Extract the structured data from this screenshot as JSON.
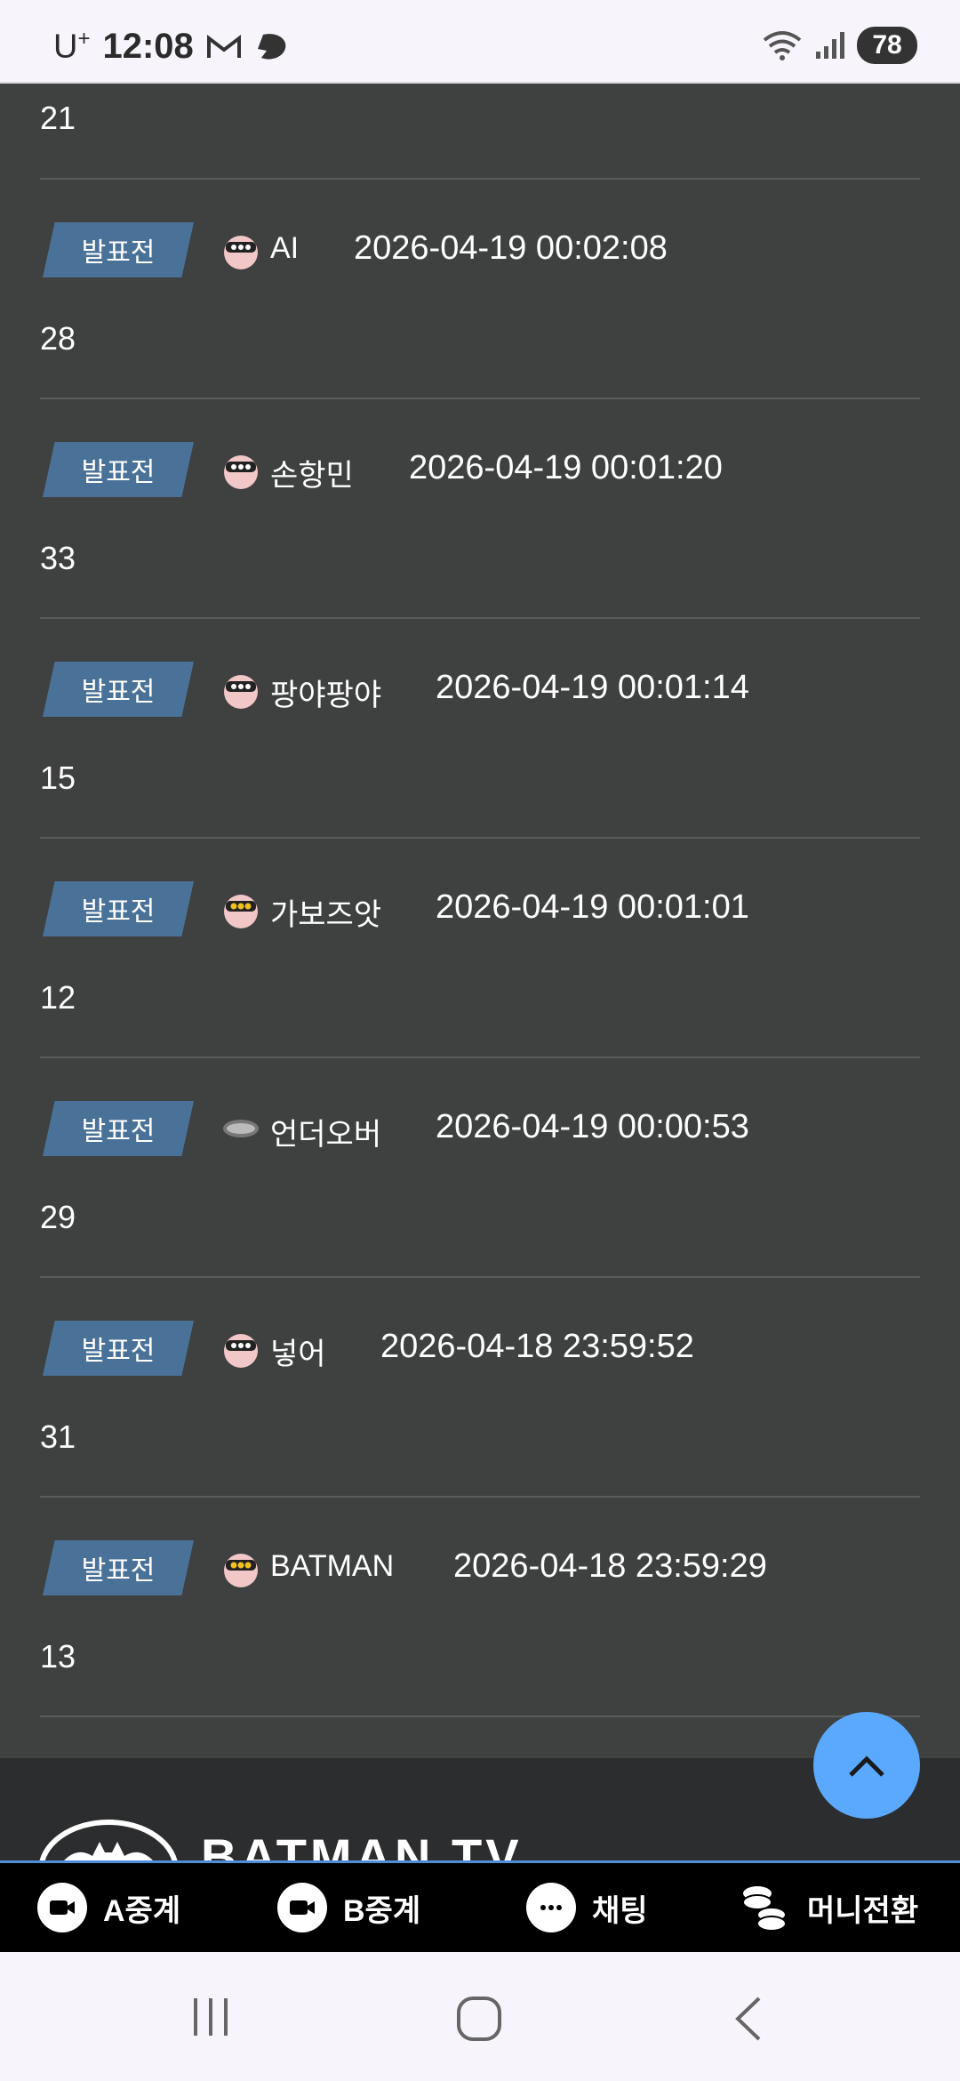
{
  "status_bar": {
    "carrier": "U",
    "carrier_sup": "+",
    "time": "12:08",
    "battery": "78"
  },
  "list": {
    "first_number": "21",
    "entries": [
      {
        "tag": "발표전",
        "name": "AI",
        "timestamp": "2026-04-19 00:02:08",
        "number": "28",
        "avatar": "star-face-icon"
      },
      {
        "tag": "발표전",
        "name": "손항민",
        "timestamp": "2026-04-19 00:01:20",
        "number": "33",
        "avatar": "star-face-icon"
      },
      {
        "tag": "발표전",
        "name": "팡야팡야",
        "timestamp": "2026-04-19 00:01:14",
        "number": "15",
        "avatar": "star-face-icon"
      },
      {
        "tag": "발표전",
        "name": "가보즈앗",
        "timestamp": "2026-04-19 00:01:01",
        "number": "12",
        "avatar": "gold-star-face-icon"
      },
      {
        "tag": "발표전",
        "name": "언더오버",
        "timestamp": "2026-04-19 00:00:53",
        "number": "29",
        "avatar": "team-logo-icon"
      },
      {
        "tag": "발표전",
        "name": "넣어",
        "timestamp": "2026-04-18 23:59:52",
        "number": "31",
        "avatar": "star-face-icon"
      },
      {
        "tag": "발표전",
        "name": "BATMAN",
        "timestamp": "2026-04-18 23:59:29",
        "number": "13",
        "avatar": "gold-star-face-icon"
      }
    ]
  },
  "footer": {
    "brand": "BATMAN TV"
  },
  "bottom_nav": {
    "items": [
      {
        "label": "A중계",
        "icon": "video-camera-icon"
      },
      {
        "label": "B중계",
        "icon": "video-camera-icon"
      },
      {
        "label": "채팅",
        "icon": "chat-bubble-icon"
      },
      {
        "label": "머니전환",
        "icon": "coins-icon"
      }
    ]
  },
  "colors": {
    "background": "#3f4040",
    "tag": "#4a7299",
    "scroll_button": "#5aa9ff",
    "nav_bar": "#000000"
  }
}
